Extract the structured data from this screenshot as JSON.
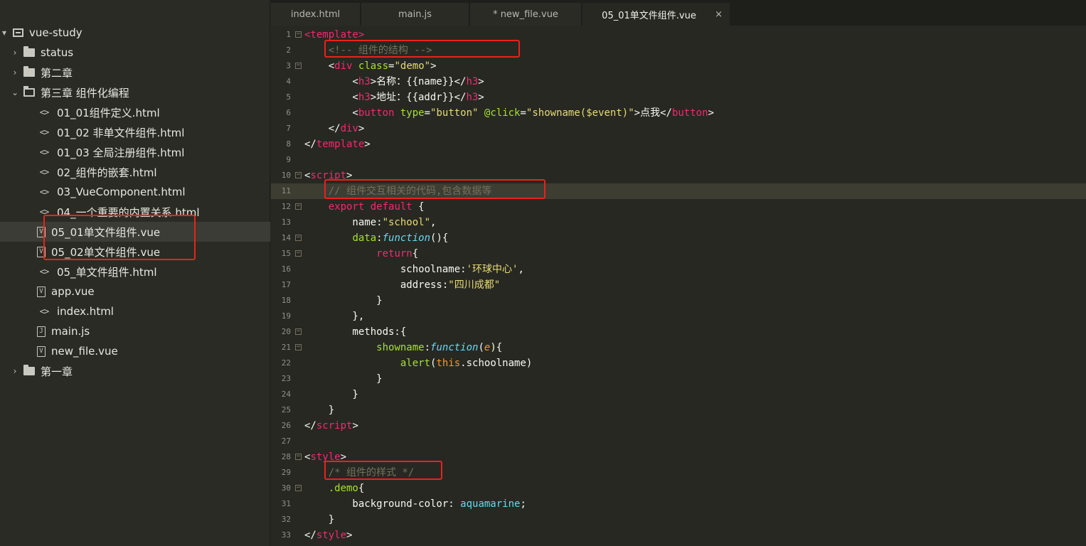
{
  "sidebar": {
    "items": [
      {
        "label": "vue-study",
        "type": "root",
        "arrow": "▾"
      },
      {
        "label": "status",
        "type": "folder",
        "arrow": "›"
      },
      {
        "label": "第二章",
        "type": "folder",
        "arrow": "›"
      },
      {
        "label": "第三章 组件化编程",
        "type": "folder-open",
        "arrow": "⌄"
      },
      {
        "label": "01_01组件定义.html",
        "type": "html"
      },
      {
        "label": "01_02 非单文件组件.html",
        "type": "html"
      },
      {
        "label": "01_03 全局注册组件.html",
        "type": "html"
      },
      {
        "label": "02_组件的嵌套.html",
        "type": "html"
      },
      {
        "label": "03_VueComponent.html",
        "type": "html"
      },
      {
        "label": "04_一个重要的内置关系.html",
        "type": "html"
      },
      {
        "label": "05_01单文件组件.vue",
        "type": "vue",
        "selected": true
      },
      {
        "label": "05_02单文件组件.vue",
        "type": "vue"
      },
      {
        "label": "05_单文件组件.html",
        "type": "html"
      },
      {
        "label": "app.vue",
        "type": "vue"
      },
      {
        "label": "index.html",
        "type": "html"
      },
      {
        "label": "main.js",
        "type": "js"
      },
      {
        "label": "new_file.vue",
        "type": "vue"
      },
      {
        "label": "第一章",
        "type": "folder",
        "arrow": "›"
      }
    ],
    "icon_glyphs": {
      "html": "<>",
      "vue": "V",
      "js": "J"
    }
  },
  "tabs": [
    {
      "label": "index.html"
    },
    {
      "label": "main.js"
    },
    {
      "label": "* new_file.vue"
    },
    {
      "label": "05_01单文件组件.vue",
      "active": true,
      "close": "×"
    }
  ],
  "editor": {
    "current_line": 11,
    "lines": [
      {
        "n": "1",
        "fold": "⊟",
        "tokens": [
          [
            "t",
            "<template>"
          ]
        ]
      },
      {
        "n": "2",
        "tokens": [
          [
            "",
            "    "
          ],
          [
            "c",
            "<!-- 组件的结构 -->"
          ]
        ]
      },
      {
        "n": "3",
        "fold": "⊟",
        "tokens": [
          [
            "",
            "    <"
          ],
          [
            "t",
            "div"
          ],
          [
            "",
            " "
          ],
          [
            "a",
            "class"
          ],
          [
            "",
            "="
          ],
          [
            "s",
            "\"demo\""
          ],
          [
            "",
            ">"
          ]
        ]
      },
      {
        "n": "4",
        "tokens": [
          [
            "",
            "        <"
          ],
          [
            "t",
            "h3"
          ],
          [
            "",
            ">名称：{{name}}</"
          ],
          [
            "t",
            "h3"
          ],
          [
            "",
            ">"
          ]
        ]
      },
      {
        "n": "5",
        "tokens": [
          [
            "",
            "        <"
          ],
          [
            "t",
            "h3"
          ],
          [
            "",
            ">地址：{{addr}}</"
          ],
          [
            "t",
            "h3"
          ],
          [
            "",
            ">"
          ]
        ]
      },
      {
        "n": "6",
        "tokens": [
          [
            "",
            "        <"
          ],
          [
            "t",
            "button"
          ],
          [
            "",
            " "
          ],
          [
            "a",
            "type"
          ],
          [
            "",
            "="
          ],
          [
            "s",
            "\"button\""
          ],
          [
            "",
            " "
          ],
          [
            "a",
            "@click"
          ],
          [
            "",
            "="
          ],
          [
            "s",
            "\"showname($event)\""
          ],
          [
            "",
            ">点我</"
          ],
          [
            "t",
            "button"
          ],
          [
            "",
            ">"
          ]
        ]
      },
      {
        "n": "7",
        "tokens": [
          [
            "",
            "    </"
          ],
          [
            "t",
            "div"
          ],
          [
            "",
            ">"
          ]
        ]
      },
      {
        "n": "8",
        "tokens": [
          [
            "",
            "</"
          ],
          [
            "t",
            "template"
          ],
          [
            "",
            ">"
          ]
        ]
      },
      {
        "n": "9",
        "tokens": []
      },
      {
        "n": "10",
        "fold": "⊟",
        "tokens": [
          [
            "",
            "<"
          ],
          [
            "t",
            "script"
          ],
          [
            "",
            ">"
          ]
        ]
      },
      {
        "n": "11",
        "tokens": [
          [
            "",
            "    "
          ],
          [
            "c",
            "// 组件交互相关的代码,包含数据等"
          ]
        ]
      },
      {
        "n": "12",
        "fold": "⊟",
        "tokens": [
          [
            "",
            "    "
          ],
          [
            "k",
            "export"
          ],
          [
            "",
            " "
          ],
          [
            "k",
            "default"
          ],
          [
            "",
            " {"
          ]
        ]
      },
      {
        "n": "13",
        "tokens": [
          [
            "",
            "        name:"
          ],
          [
            "s",
            "\"school\""
          ],
          [
            "",
            ","
          ]
        ]
      },
      {
        "n": "14",
        "fold": "⊟",
        "tokens": [
          [
            "",
            "        "
          ],
          [
            "a",
            "data"
          ],
          [
            "",
            ":"
          ],
          [
            "f",
            "function"
          ],
          [
            "",
            "(){"
          ]
        ]
      },
      {
        "n": "15",
        "fold": "⊟",
        "tokens": [
          [
            "",
            "            "
          ],
          [
            "k",
            "return"
          ],
          [
            "",
            "{"
          ]
        ]
      },
      {
        "n": "16",
        "tokens": [
          [
            "",
            "                schoolname:"
          ],
          [
            "s",
            "'环球中心'"
          ],
          [
            "",
            ","
          ]
        ]
      },
      {
        "n": "17",
        "tokens": [
          [
            "",
            "                address:"
          ],
          [
            "s",
            "\"四川成都\""
          ]
        ]
      },
      {
        "n": "18",
        "tokens": [
          [
            "",
            "            }"
          ]
        ]
      },
      {
        "n": "19",
        "tokens": [
          [
            "",
            "        },"
          ]
        ]
      },
      {
        "n": "20",
        "fold": "⊟",
        "tokens": [
          [
            "",
            "        methods:{"
          ]
        ]
      },
      {
        "n": "21",
        "fold": "⊟",
        "tokens": [
          [
            "",
            "            "
          ],
          [
            "a",
            "showname"
          ],
          [
            "",
            ":"
          ],
          [
            "f",
            "function"
          ],
          [
            "",
            "("
          ],
          [
            "p",
            "e"
          ],
          [
            "",
            "){"
          ]
        ]
      },
      {
        "n": "22",
        "tokens": [
          [
            "",
            "                "
          ],
          [
            "a",
            "alert"
          ],
          [
            "",
            "("
          ],
          [
            "i",
            "this"
          ],
          [
            "",
            ".schoolname)"
          ]
        ]
      },
      {
        "n": "23",
        "tokens": [
          [
            "",
            "            }"
          ]
        ]
      },
      {
        "n": "24",
        "tokens": [
          [
            "",
            "        }"
          ]
        ]
      },
      {
        "n": "25",
        "tokens": [
          [
            "",
            "    }"
          ]
        ]
      },
      {
        "n": "26",
        "tokens": [
          [
            "",
            "</"
          ],
          [
            "t",
            "script"
          ],
          [
            "",
            ">"
          ]
        ]
      },
      {
        "n": "27",
        "tokens": []
      },
      {
        "n": "28",
        "fold": "⊟",
        "tokens": [
          [
            "",
            "<"
          ],
          [
            "t",
            "style"
          ],
          [
            "",
            ">"
          ]
        ]
      },
      {
        "n": "29",
        "tokens": [
          [
            "",
            "    "
          ],
          [
            "c",
            "/* 组件的样式 */"
          ]
        ]
      },
      {
        "n": "30",
        "fold": "⊟",
        "tokens": [
          [
            "",
            "    "
          ],
          [
            "a",
            ".demo"
          ],
          [
            "",
            "{"
          ]
        ]
      },
      {
        "n": "31",
        "tokens": [
          [
            "",
            "        background-color: "
          ],
          [
            "v",
            "aquamarine"
          ],
          [
            "",
            ";"
          ]
        ]
      },
      {
        "n": "32",
        "tokens": [
          [
            "",
            "    }"
          ]
        ]
      },
      {
        "n": "33",
        "tokens": [
          [
            "",
            "</"
          ],
          [
            "t",
            "style"
          ],
          [
            "",
            ">"
          ]
        ]
      }
    ]
  },
  "colors": {
    "highlight_box": "#e8231b",
    "editor_bg": "#272822",
    "sidebar_bg": "#2a2b25"
  }
}
